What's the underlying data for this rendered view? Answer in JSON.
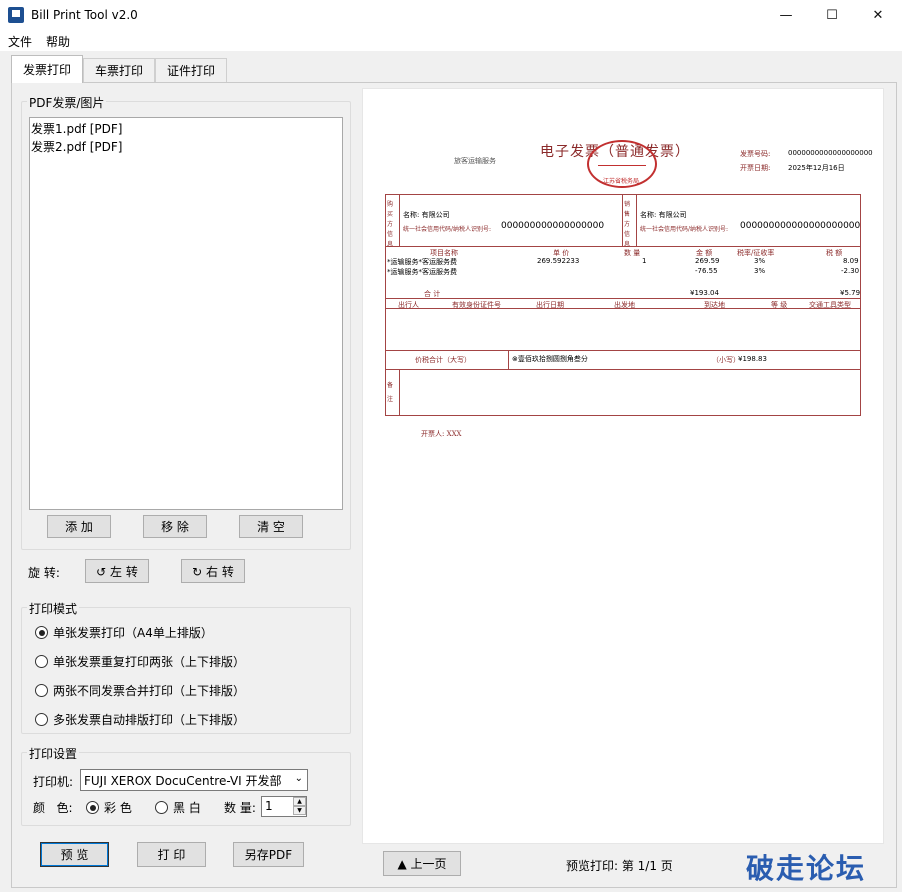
{
  "window": {
    "title": "Bill Print Tool v2.0",
    "minimize": "—",
    "maximize": "☐",
    "close": "✕"
  },
  "menu": [
    "文件",
    "帮助"
  ],
  "tabs": [
    "发票打印",
    "车票打印",
    "证件打印"
  ],
  "file_group": {
    "title": "PDF发票/图片",
    "files": [
      "发票1.pdf [PDF]",
      "发票2.pdf [PDF]"
    ],
    "add": "添 加",
    "remove": "移 除",
    "clear": "清 空"
  },
  "rotate": {
    "label": "旋 转:",
    "left": "↺ 左 转",
    "right": "↻ 右 转"
  },
  "print_mode": {
    "title": "打印模式",
    "options": [
      "单张发票打印（A4单上排版）",
      "单张发票重复打印两张（上下排版）",
      "两张不同发票合并打印（上下排版）",
      "多张发票自动排版打印（上下排版）"
    ],
    "selected": 0
  },
  "print_settings": {
    "title": "打印设置",
    "printer_label": "打印机:",
    "printer_value": "FUJI XEROX DocuCentre-VI 开发部",
    "color_label": "颜   色:",
    "color_options": [
      "彩 色",
      "黑 白"
    ],
    "color_selected": 0,
    "qty_label": "数 量:",
    "qty_value": "1"
  },
  "actions": {
    "preview": "预 览",
    "print": "打 印",
    "save_pdf": "另存PDF"
  },
  "preview_nav": {
    "prev": "▲ 上一页",
    "status": "预览打印: 第 1/1 页"
  },
  "watermark": "破走论坛",
  "invoice": {
    "title": "电子发票（普通发票）",
    "category": "旅客运输服务",
    "seal_text": "江苏省税务局",
    "number_label": "发票号码:",
    "number_value": "0000000000000000000",
    "date_label": "开票日期:",
    "date_value": "2025年12月16日",
    "buyer_side": "购买方信息",
    "seller_side": "销售方信息",
    "buyer_name": "名称: 有限公司",
    "buyer_tax_label": "统一社会信用代码/纳税人识别号:",
    "buyer_tax_value": "000000000000000000",
    "seller_name": "名称: 有限公司",
    "seller_tax_label": "统一社会信用代码/纳税人识别号:",
    "seller_tax_value": "000000000000000000000",
    "item_headers": [
      "项目名称",
      "单 价",
      "数 量",
      "金 额",
      "税率/征收率",
      "税 额"
    ],
    "items": [
      [
        "*运输服务*客运服务费",
        "269.592233",
        "1",
        "269.59",
        "3%",
        "8.09"
      ],
      [
        "*运输服务*客运服务费",
        "",
        "",
        "-76.55",
        "3%",
        "-2.30"
      ]
    ],
    "total_label": "合   计",
    "total_amount": "¥193.04",
    "total_tax": "¥5.79",
    "travel_headers": [
      "出行人",
      "有效身份证件号",
      "出行日期",
      "出发地",
      "到达地",
      "等 级",
      "交通工具类型"
    ],
    "total_words_label": "价税合计（大写）",
    "total_words": "⊗壹佰玖拾捌圆捌角叁分",
    "total_small_label": "（小写）",
    "total_small_value": "¥198.83",
    "remark_side": "备注",
    "issuer": "开票人: XXX"
  }
}
